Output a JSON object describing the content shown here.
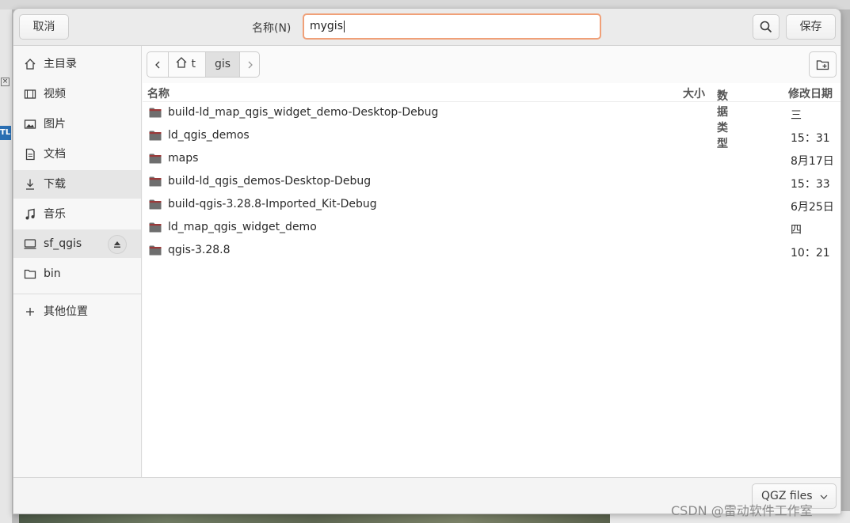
{
  "header": {
    "cancel_label": "取消",
    "name_label": "名称(N)",
    "name_value": "mygis",
    "save_label": "保存"
  },
  "sidebar": {
    "items": [
      {
        "label": "主目录",
        "icon": "home-icon"
      },
      {
        "label": "视频",
        "icon": "video-icon"
      },
      {
        "label": "图片",
        "icon": "image-icon"
      },
      {
        "label": "文档",
        "icon": "document-icon"
      },
      {
        "label": "下载",
        "icon": "download-icon"
      },
      {
        "label": "音乐",
        "icon": "music-icon"
      },
      {
        "label": "sf_qgis",
        "icon": "drive-icon"
      },
      {
        "label": "bin",
        "icon": "folder-icon"
      },
      {
        "label": "其他位置",
        "icon": "plus-icon"
      }
    ]
  },
  "pathbar": {
    "home_label": "t",
    "current": "gis"
  },
  "columns": {
    "name": "名称",
    "size": "大小",
    "type": "数据类型",
    "modified": "修改日期"
  },
  "files": [
    {
      "name": "build-ld_map_qgis_widget_demo-Desktop-Debug",
      "date": "三"
    },
    {
      "name": "ld_qgis_demos",
      "date": "15：31"
    },
    {
      "name": "maps",
      "date": "8月17日"
    },
    {
      "name": "build-ld_qgis_demos-Desktop-Debug",
      "date": "15：33"
    },
    {
      "name": "build-qgis-3.28.8-Imported_Kit-Debug",
      "date": "6月25日"
    },
    {
      "name": "ld_map_qgis_widget_demo",
      "date": "四"
    },
    {
      "name": "qgis-3.28.8",
      "date": "10：21"
    }
  ],
  "footer": {
    "filter_label": "QGZ files"
  },
  "background": {
    "left_tag": "TL"
  },
  "watermark": "CSDN @雷动软件工作室",
  "colors": {
    "focus_border": "#f0a078",
    "folder": "#6e6e6e",
    "folder_tab": "#9b3a3a"
  }
}
